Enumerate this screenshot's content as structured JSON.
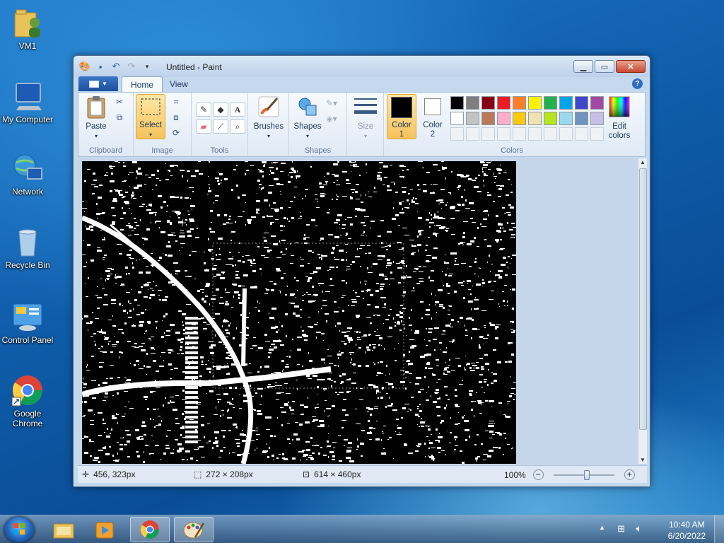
{
  "desktop": {
    "icons": [
      {
        "label": "VM1",
        "icon": "user-folder-icon"
      },
      {
        "label": "My Computer",
        "icon": "computer-icon"
      },
      {
        "label": "Network",
        "icon": "network-icon"
      },
      {
        "label": "Recycle Bin",
        "icon": "recycle-bin-icon"
      },
      {
        "label": "Control Panel",
        "icon": "control-panel-icon"
      },
      {
        "label": "Google Chrome",
        "icon": "chrome-icon"
      }
    ]
  },
  "window": {
    "title": "Untitled - Paint",
    "tabs": {
      "file": "",
      "home": "Home",
      "view": "View"
    },
    "ribbon": {
      "clipboard": {
        "paste": "Paste",
        "group": "Clipboard"
      },
      "image": {
        "select": "Select",
        "group": "Image"
      },
      "tools": {
        "group": "Tools"
      },
      "brushes": {
        "label": "Brushes"
      },
      "shapes": {
        "label": "Shapes",
        "group": "Shapes"
      },
      "size": {
        "label": "Size"
      },
      "colors": {
        "color1_line1": "Color",
        "color1_line2": "1",
        "color2_line1": "Color",
        "color2_line2": "2",
        "color1_value": "#000000",
        "color2_value": "#ffffff",
        "edit_line1": "Edit",
        "edit_line2": "colors",
        "group": "Colors",
        "row1": [
          "#000000",
          "#7f7f7f",
          "#880015",
          "#ed1c24",
          "#ff7f27",
          "#fff200",
          "#22b14c",
          "#00a2e8",
          "#3f48cc",
          "#a349a4"
        ],
        "row2": [
          "#ffffff",
          "#c3c3c3",
          "#b97a57",
          "#ffaec9",
          "#ffc90e",
          "#efe4b0",
          "#b5e61d",
          "#99d9ea",
          "#7092be",
          "#c8bfe7"
        ]
      }
    },
    "status": {
      "cursor_pos": "456, 323px",
      "selection_size": "272 × 208px",
      "image_size": "614 × 460px",
      "zoom": "100%",
      "zoom_slider_value": 0.55
    }
  },
  "taskbar": {
    "apps": [
      "windows-explorer-icon",
      "media-player-icon",
      "chrome-icon",
      "paint-icon"
    ],
    "time": "10:40 AM",
    "date": "6/20/2022"
  }
}
